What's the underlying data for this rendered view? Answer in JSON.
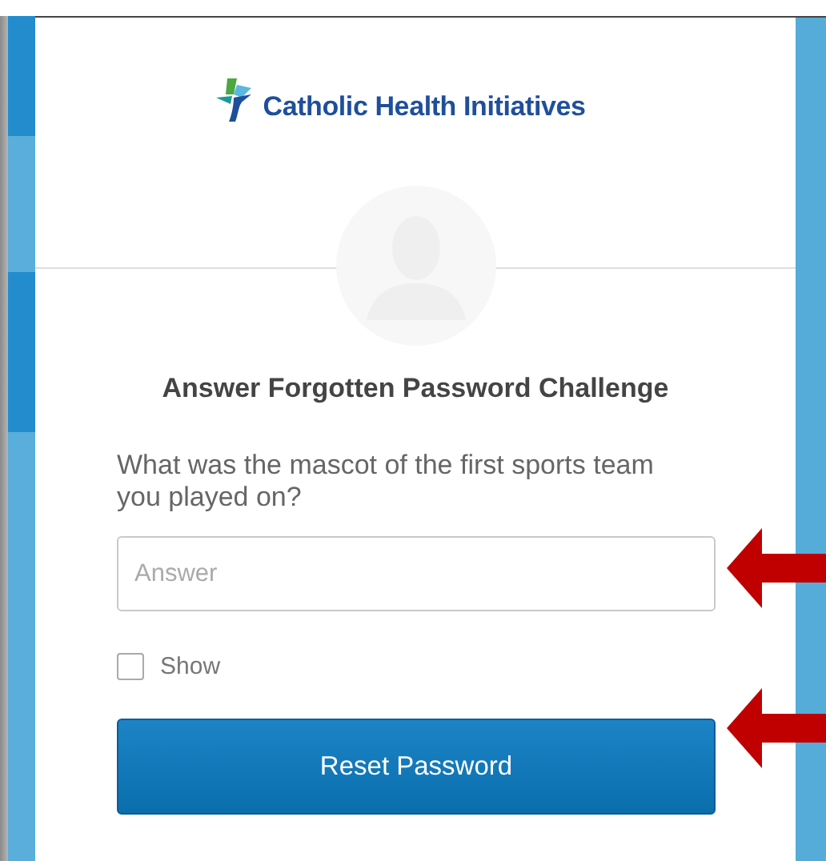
{
  "logo": {
    "text": "Catholic Health Initiatives"
  },
  "title": "Answer Forgotten Password Challenge",
  "question": "What was the mascot of the first sports team you played on?",
  "answer_field": {
    "placeholder": "Answer"
  },
  "show_checkbox": {
    "label": "Show",
    "checked": false
  },
  "submit_button": {
    "label": "Reset Password"
  }
}
